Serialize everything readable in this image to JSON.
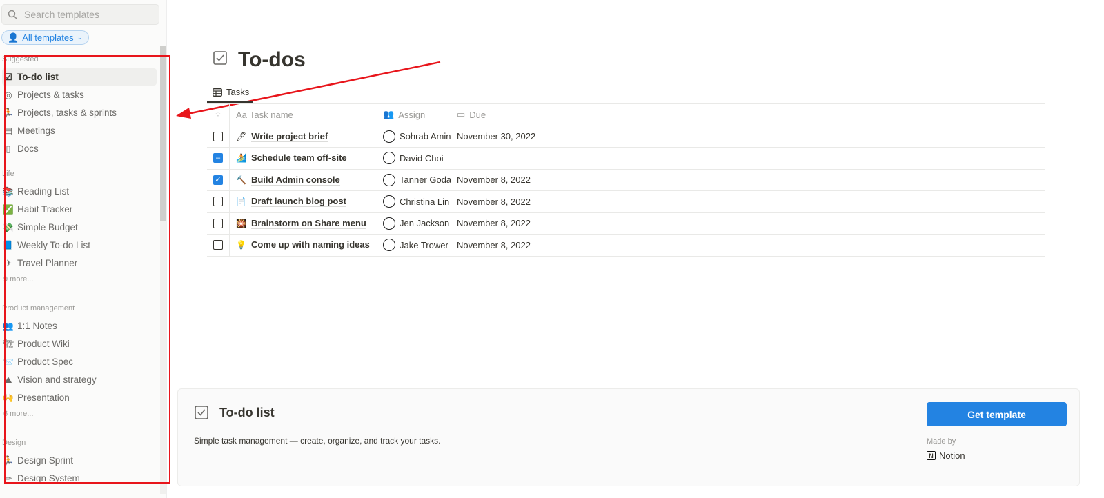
{
  "sidebar": {
    "search_placeholder": "Search templates",
    "filter_label": "All templates",
    "sections": [
      {
        "title": "Suggested",
        "items": [
          {
            "label": "To-do list",
            "icon": "☑",
            "active": true
          },
          {
            "label": "Projects & tasks",
            "icon": "◎"
          },
          {
            "label": "Projects, tasks & sprints",
            "icon": "🏃"
          },
          {
            "label": "Meetings",
            "icon": "▤"
          },
          {
            "label": "Docs",
            "icon": "▯"
          }
        ]
      },
      {
        "title": "Life",
        "items": [
          {
            "label": "Reading List",
            "icon": "📚"
          },
          {
            "label": "Habit Tracker",
            "icon": "✅"
          },
          {
            "label": "Simple Budget",
            "icon": "💸"
          },
          {
            "label": "Weekly To-do List",
            "icon": "📘"
          },
          {
            "label": "Travel Planner",
            "icon": "✈"
          }
        ],
        "more": "9 more..."
      },
      {
        "title": "Product management",
        "items": [
          {
            "label": "1:1 Notes",
            "icon": "👥"
          },
          {
            "label": "Product Wiki",
            "icon": "🏗"
          },
          {
            "label": "Product Spec",
            "icon": "📨"
          },
          {
            "label": "Vision and strategy",
            "icon": "⛰"
          },
          {
            "label": "Presentation",
            "icon": "🙌"
          }
        ],
        "more": "6 more..."
      },
      {
        "title": "Design",
        "items": [
          {
            "label": "Design Sprint",
            "icon": "🏃"
          },
          {
            "label": "Design System",
            "icon": "✏"
          }
        ]
      }
    ]
  },
  "preview": {
    "title": "To-dos",
    "tab": "Tasks",
    "columns": {
      "name": "Task name",
      "name_prefix": "Aa",
      "assign": "Assign",
      "due": "Due"
    },
    "rows": [
      {
        "state": "unchecked",
        "icon": "🖊",
        "name": "Write project brief",
        "assignee": "Sohrab Amin",
        "due": "November 30, 2022"
      },
      {
        "state": "partial",
        "icon": "🏄",
        "name": "Schedule team off-site",
        "assignee": "David Choi",
        "due": ""
      },
      {
        "state": "checked",
        "icon": "🔨",
        "name": "Build Admin console",
        "assignee": "Tanner Godar",
        "due": "November 8, 2022"
      },
      {
        "state": "unchecked",
        "icon": "📄",
        "name": "Draft launch blog post",
        "assignee": "Christina Lin",
        "due": "November 8, 2022"
      },
      {
        "state": "unchecked",
        "icon": "🎇",
        "name": "Brainstorm on Share menu",
        "assignee": "Jen Jackson",
        "due": "November 8, 2022"
      },
      {
        "state": "unchecked",
        "icon": "💡",
        "name": "Come up with naming ideas",
        "assignee": "Jake Trower",
        "due": "November 8, 2022"
      }
    ]
  },
  "card": {
    "title": "To-do list",
    "description": "Simple task management — create, organize, and track your tasks.",
    "button": "Get template",
    "made_by_label": "Made by",
    "maker": "Notion"
  },
  "colors": {
    "accent": "#2383e2",
    "annotation": "#e8151b"
  }
}
